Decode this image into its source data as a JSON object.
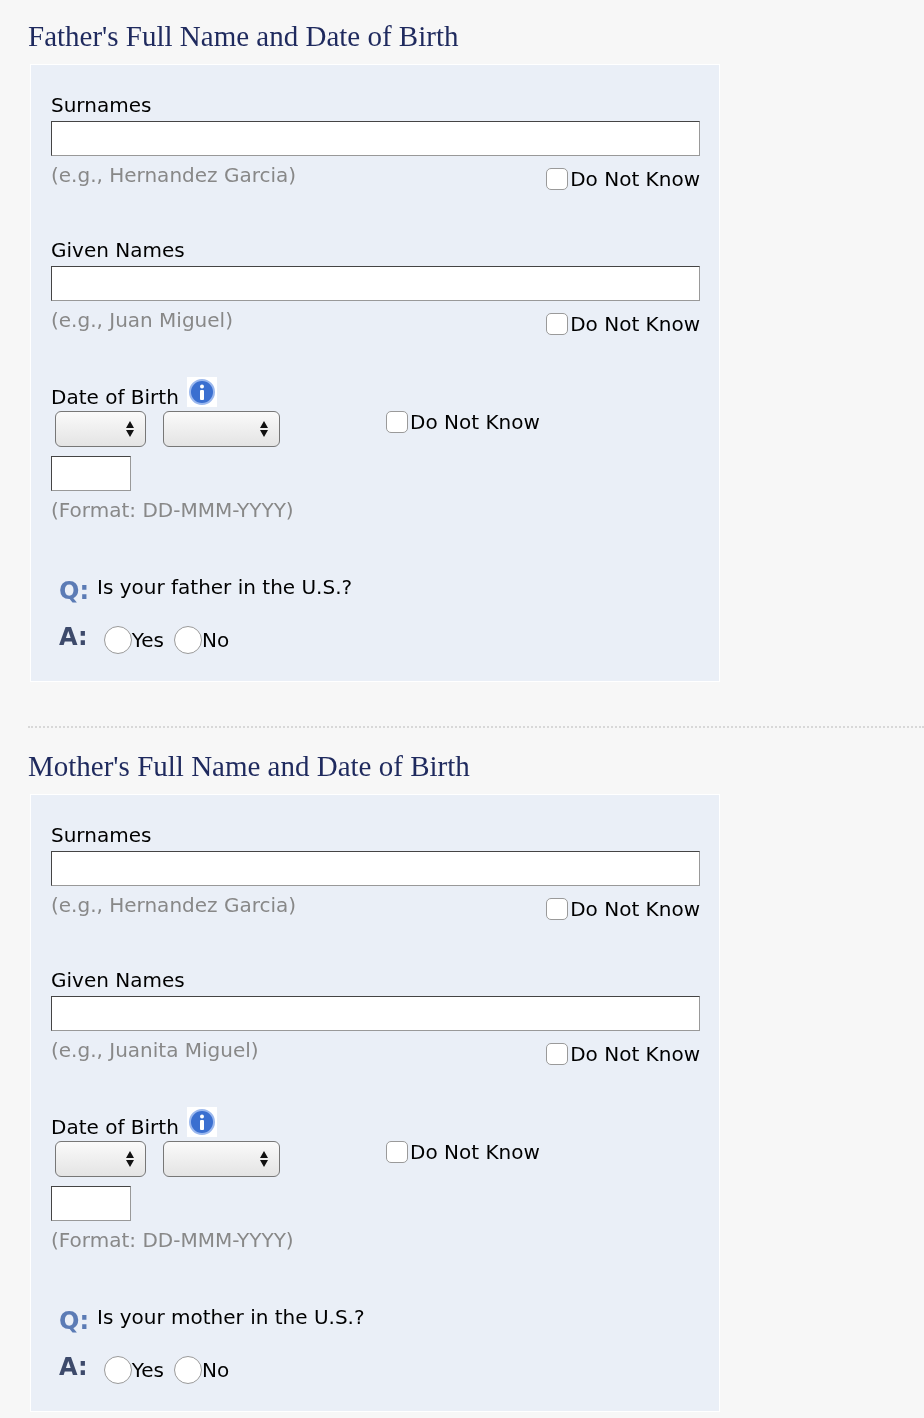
{
  "sections": [
    {
      "title": "Father's Full Name and Date of Birth",
      "fields": [
        {
          "label": "Surnames",
          "hint": "(e.g., Hernandez Garcia)",
          "do_not_know": {
            "label": "Do Not Know",
            "checked": false
          }
        },
        {
          "label": "Given Names",
          "hint": "(e.g., Juan Miguel)",
          "do_not_know": {
            "label": "Do Not Know",
            "checked": false
          }
        }
      ],
      "dob": {
        "label": "Date of Birth",
        "do_not_know": {
          "label": "Do Not Know",
          "checked": false
        },
        "format_hint": "(Format: DD-MMM-YYYY)"
      },
      "question": {
        "q_mark": "Q:",
        "text": "Is your father in the U.S.?",
        "a_mark": "A:",
        "options": [
          {
            "label": "Yes",
            "selected": false
          },
          {
            "label": "No",
            "selected": false
          }
        ]
      }
    },
    {
      "title": "Mother's Full Name and Date of Birth",
      "fields": [
        {
          "label": "Surnames",
          "hint": "(e.g., Hernandez Garcia)",
          "do_not_know": {
            "label": "Do Not Know",
            "checked": false
          }
        },
        {
          "label": "Given Names",
          "hint": "(e.g., Juanita Miguel)",
          "do_not_know": {
            "label": "Do Not Know",
            "checked": false
          }
        }
      ],
      "dob": {
        "label": "Date of Birth",
        "do_not_know": {
          "label": "Do Not Know",
          "checked": false
        },
        "format_hint": "(Format: DD-MMM-YYYY)"
      },
      "question": {
        "q_mark": "Q:",
        "text": "Is your mother in the U.S.?",
        "a_mark": "A:",
        "options": [
          {
            "label": "Yes",
            "selected": false
          },
          {
            "label": "No",
            "selected": false
          }
        ]
      }
    }
  ]
}
